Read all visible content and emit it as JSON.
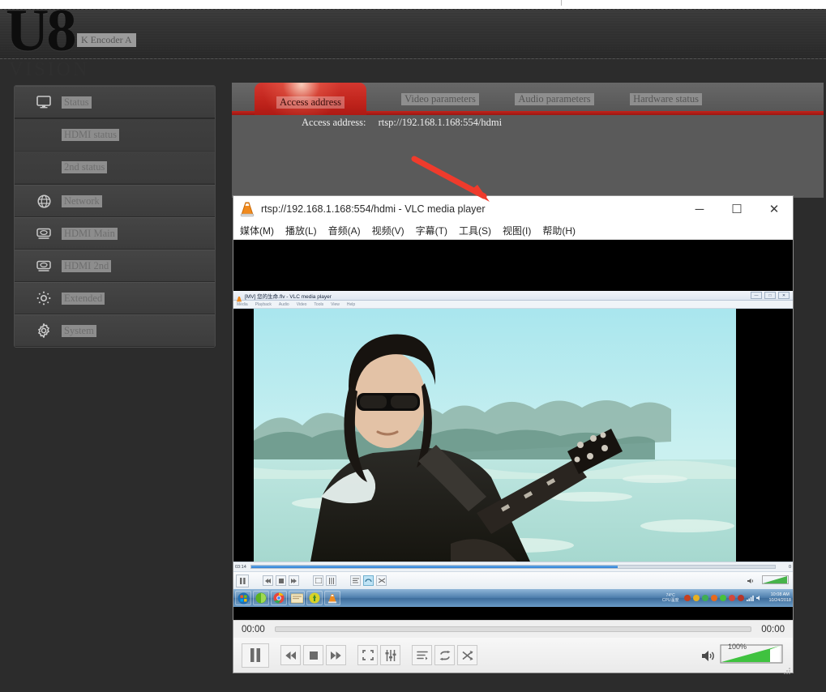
{
  "branding": {
    "logo_primary": "U8",
    "logo_secondary": "VISION",
    "encoder_chip": "K Encoder  A"
  },
  "sidebar": {
    "items": [
      {
        "label": "Status",
        "icon": "monitor-icon",
        "type": "main"
      },
      {
        "label": "HDMI status",
        "icon": "",
        "type": "sub"
      },
      {
        "label": "2nd status",
        "icon": "",
        "type": "sub"
      },
      {
        "label": "Network",
        "icon": "globe-icon",
        "type": "main"
      },
      {
        "label": "HDMI Main",
        "icon": "hdmi-icon",
        "type": "main"
      },
      {
        "label": "HDMI 2nd",
        "icon": "hdmi-icon",
        "type": "main"
      },
      {
        "label": "Extended",
        "icon": "gear-dots-icon",
        "type": "main"
      },
      {
        "label": "System",
        "icon": "gear-icon",
        "type": "main"
      }
    ]
  },
  "main": {
    "tabs": [
      {
        "label": "Access address",
        "active": true
      },
      {
        "label": "Video parameters",
        "active": false
      },
      {
        "label": "Audio parameters",
        "active": false
      },
      {
        "label": "Hardware status",
        "active": false
      }
    ],
    "access_address_label": "Access address:",
    "access_address_value": "rtsp://192.168.1.168:554/hdmi",
    "accent_color": "#c1241c",
    "arrow_color": "#ef3b2c"
  },
  "vlc": {
    "title": "rtsp://192.168.1.168:554/hdmi - VLC media player",
    "window_buttons": {
      "minimize": "─",
      "maximize": "☐",
      "close": "✕"
    },
    "menu": [
      "媒体(M)",
      "播放(L)",
      "音频(A)",
      "视频(V)",
      "字幕(T)",
      "工具(S)",
      "视图(I)",
      "帮助(H)"
    ],
    "time_elapsed": "00:00",
    "time_total": "00:00",
    "volume_percent": "100%",
    "controls": [
      "play-pause-button",
      "previous-button",
      "stop-button",
      "next-button",
      "fullscreen-button",
      "extended-settings-button",
      "playlist-button",
      "loop-button",
      "random-button"
    ]
  },
  "nested_vlc": {
    "title": "[MV] 您的生命.flv - VLC media player",
    "menu": [
      "Media",
      "Playback",
      "Audio",
      "Video",
      "Tools",
      "View",
      "Help"
    ],
    "time_elapsed": "03:14",
    "time_total": "0",
    "taskbar": {
      "cpu_temp": "74°C",
      "cpu_label": "CPU温度",
      "clock_time": "10:08 AM",
      "clock_date": "10/24/2018"
    }
  }
}
